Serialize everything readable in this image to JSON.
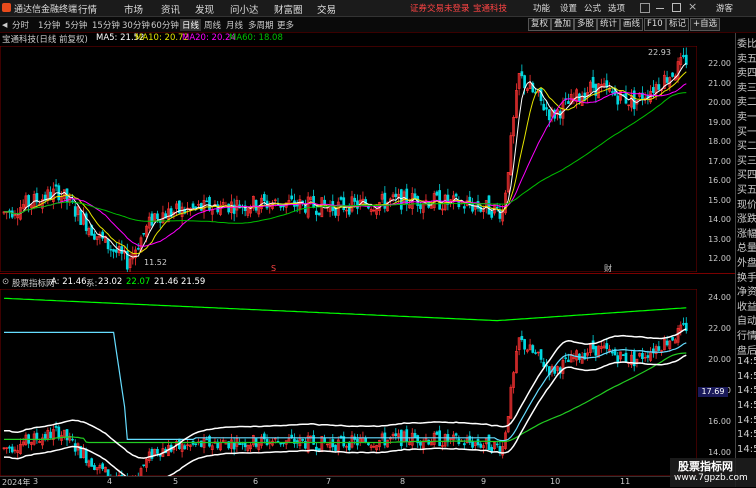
{
  "app": {
    "title": "通达信金融终端",
    "menus": [
      "行情",
      "市场",
      "资讯",
      "发现",
      "问小达",
      "财富圈",
      "交易"
    ],
    "center_notice": "证券交易未登录",
    "center_stock": "宝通科技",
    "right_menus": [
      "功能",
      "设置",
      "公式",
      "选项",
      "游客"
    ]
  },
  "toolbar": {
    "periods": [
      "分时",
      "1分钟",
      "5分钟",
      "15分钟",
      "30分钟",
      "60分钟",
      "日线",
      "周线",
      "月线",
      "多周期",
      "更多"
    ],
    "active_period": "日线",
    "right_buttons": [
      "复权",
      "叠加",
      "多股",
      "统计",
      "画线",
      "F10",
      "标记",
      "+自选"
    ]
  },
  "main_info": {
    "name": "宝通科技(日线 前复权)",
    "ma5": "MA5: 21.52",
    "ma10": "MA10: 20.72",
    "ma20": "MA20: 20.24",
    "ma60": "MA60: 18.08",
    "high_label": "22.93",
    "low_label": "11.52",
    "colors": {
      "ma5": "#ffffff",
      "ma10": "#e5e500",
      "ma20": "#ff00ff",
      "ma60": "#00c000",
      "up": "#ff3333",
      "down": "#00ffff"
    }
  },
  "main_yaxis": [
    "22.00",
    "21.00",
    "20.00",
    "19.00",
    "18.00",
    "17.00",
    "16.00",
    "15.00",
    "14.00",
    "13.00",
    "12.00"
  ],
  "sub_info": {
    "name": "股票指标网",
    "a": "A: 21.46",
    "b": "23.02",
    "c": "22.07",
    "d": "21.46",
    "e": "21.59",
    "label_prefix": "系:"
  },
  "sub_yaxis": [
    "24.00",
    "22.00",
    "20.00",
    "18.00",
    "16.00",
    "14.00"
  ],
  "sub_value_badge": "17.69",
  "time_axis": [
    "2024年",
    "3",
    "4",
    "5",
    "6",
    "7",
    "8",
    "9",
    "10",
    "11"
  ],
  "right_panel": [
    "委比",
    "卖五",
    "卖四",
    "卖三",
    "卖二",
    "卖一",
    "买一",
    "买二",
    "买三",
    "买四",
    "买五",
    "现价",
    "涨跌",
    "涨幅",
    "总量",
    "外盘",
    "换手",
    "净资",
    "收益",
    "自动",
    "行情",
    "盘后",
    "14:5",
    "14:5",
    "14:5",
    "14:5",
    "14:5",
    "14:5",
    "14:5"
  ],
  "markers": {
    "s_marker": "S",
    "cai_marker": "财"
  },
  "watermark": {
    "line1": "股票指标网",
    "line2": "www.7gpzb.com"
  }
}
